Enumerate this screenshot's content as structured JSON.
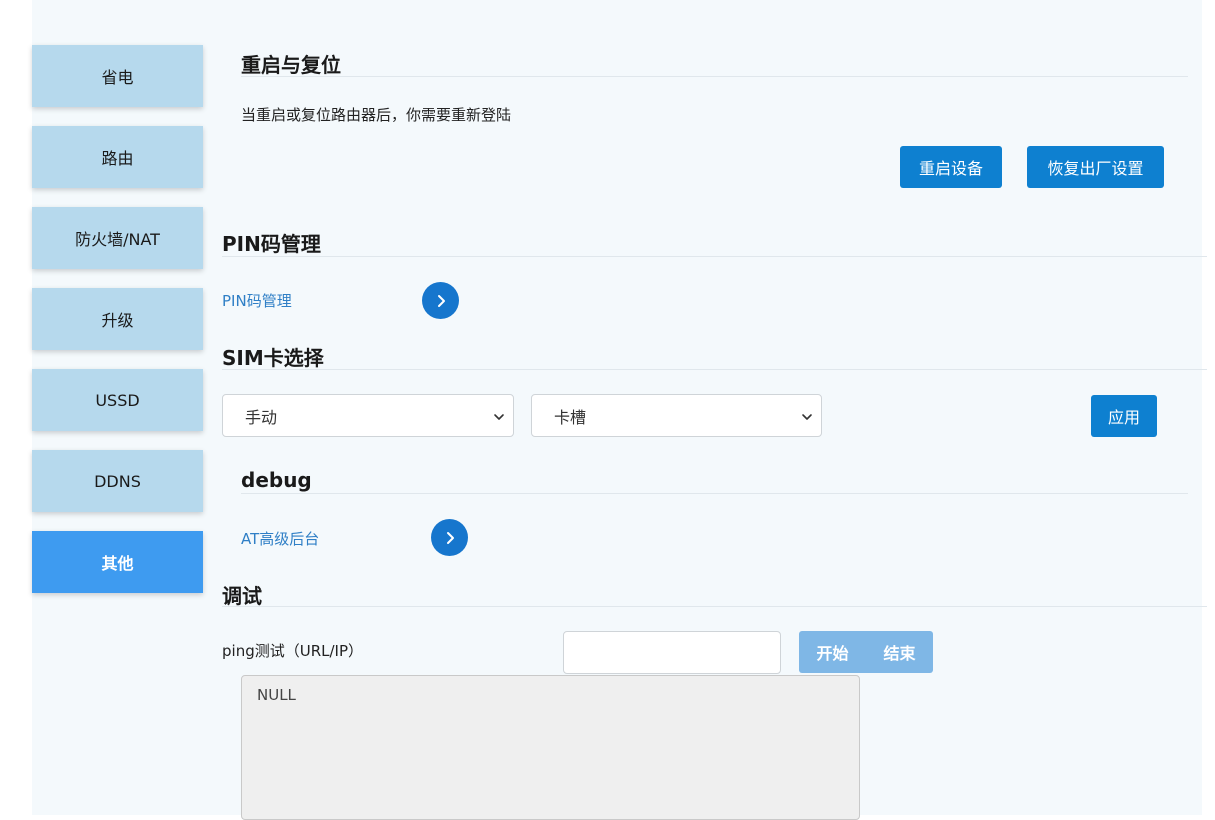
{
  "sidebar": {
    "items": [
      {
        "label": "省电"
      },
      {
        "label": "路由"
      },
      {
        "label": "防火墙/NAT"
      },
      {
        "label": "升级"
      },
      {
        "label": "USSD"
      },
      {
        "label": "DDNS"
      },
      {
        "label": "其他",
        "active": true
      }
    ]
  },
  "reboot": {
    "title": "重启与复位",
    "description": "当重启或复位路由器后，你需要重新登陆",
    "reboot_button": "重启设备",
    "reset_button": "恢复出厂设置"
  },
  "pin": {
    "title": "PIN码管理",
    "link": "PIN码管理"
  },
  "sim": {
    "title": "SIM卡选择",
    "mode_select": "手动",
    "slot_select": "卡槽",
    "apply_button": "应用"
  },
  "debug": {
    "title": "debug",
    "link": "AT高级后台"
  },
  "test": {
    "title": "调试",
    "ping_label": "ping测试（URL/IP）",
    "ping_input_value": "",
    "start_button": "开始",
    "stop_button": "结束",
    "output": "NULL"
  },
  "colors": {
    "accent": "#0e80d0",
    "nav_active": "#3e9bf0",
    "nav_inactive": "#b6d9ed",
    "link": "#2f7fc6"
  }
}
